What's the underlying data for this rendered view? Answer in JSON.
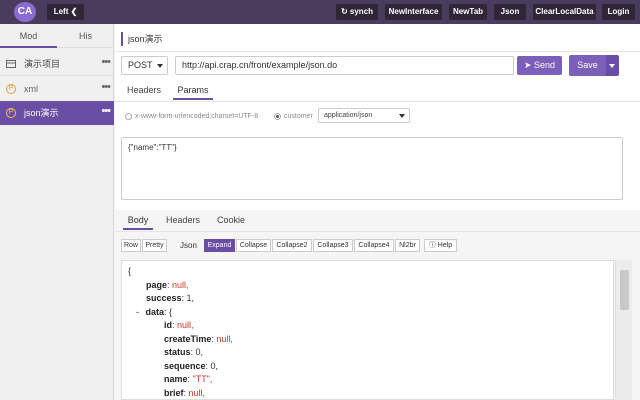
{
  "topbar": {
    "logo": "CA",
    "left_label": "Left",
    "buttons": [
      "synch",
      "NewInterface",
      "NewTab",
      "Json",
      "ClearLocalData",
      "Login"
    ]
  },
  "sidebar": {
    "tabs": [
      "Mod",
      "His"
    ],
    "items": [
      {
        "label": "演示项目",
        "icon": "folder-icon"
      },
      {
        "label": "xml",
        "icon": "circle-p-icon"
      },
      {
        "label": "json演示",
        "icon": "circle-p-icon"
      }
    ],
    "more": "•••"
  },
  "main": {
    "title": "json演示",
    "method": "POST",
    "url": "http://api.crap.cn/front/example/json.do",
    "send_label": "Send",
    "save_label": "Save",
    "request_tabs": [
      "Headers",
      "Params"
    ],
    "radio_form": "x-www-form-urlencoded;charset=UTF-8",
    "radio_custom": "customer",
    "content_type": "application/json",
    "body": "{\"name\":\"TT\"}",
    "response_tabs": [
      "Body",
      "Headers",
      "Cookie"
    ],
    "tools": [
      "Row",
      "Pretty",
      "Json",
      "Expand",
      "Collapse",
      "Collapse2",
      "Collapse3",
      "Collapse4",
      "Nl2br",
      "Help"
    ],
    "json_lines": [
      {
        "indent": 0,
        "text": "{"
      },
      {
        "indent": 1,
        "key": "page",
        "val": "null,",
        "vclass": "n"
      },
      {
        "indent": 1,
        "key": "success",
        "val": "1,",
        "vclass": "plain"
      },
      {
        "indent": 1,
        "prefix": "- ",
        "key": "data",
        "val": "{",
        "vclass": "plain"
      },
      {
        "indent": 2,
        "key": "id",
        "val": "null,",
        "vclass": "n"
      },
      {
        "indent": 2,
        "key": "createTime",
        "val": "null,",
        "vclass": "n"
      },
      {
        "indent": 2,
        "key": "status",
        "val": "0,",
        "vclass": "plain"
      },
      {
        "indent": 2,
        "key": "sequence",
        "val": "0,",
        "vclass": "plain"
      },
      {
        "indent": 2,
        "key": "name",
        "val": "\"TT\",",
        "vclass": "s"
      },
      {
        "indent": 2,
        "key": "brief",
        "val": "null,",
        "vclass": "n"
      }
    ]
  }
}
